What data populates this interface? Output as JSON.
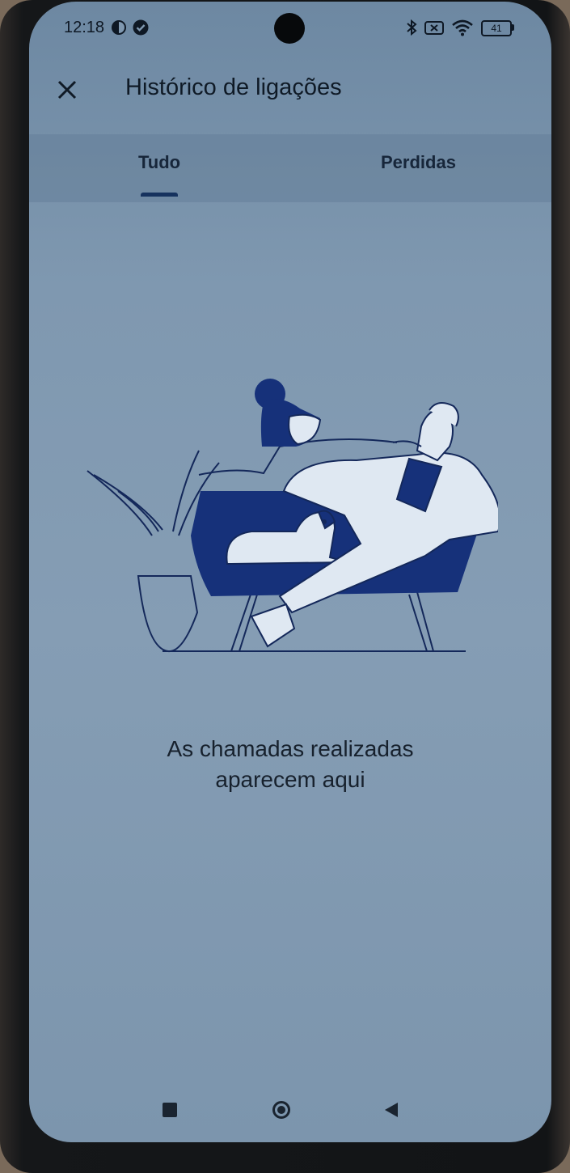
{
  "status_bar": {
    "time": "12:18",
    "battery": "41",
    "icons": [
      "data-saver-icon",
      "verified-icon",
      "bluetooth-icon",
      "sim-icon",
      "wifi-icon",
      "battery-icon"
    ]
  },
  "app_bar": {
    "title": "Histórico de ligações",
    "close_icon": "close-icon"
  },
  "tabs": [
    {
      "label": "Tudo",
      "selected": true
    },
    {
      "label": "Perdidas",
      "selected": false
    }
  ],
  "empty_state": {
    "line1": "As chamadas realizadas",
    "line2": "aparecem aqui"
  },
  "nav_bar": {
    "buttons": [
      "recents-square-icon",
      "home-circle-icon",
      "back-triangle-icon"
    ]
  },
  "colors": {
    "accent": "#16325e",
    "illustration_navy": "#16317a",
    "text": "#0f1a26"
  }
}
